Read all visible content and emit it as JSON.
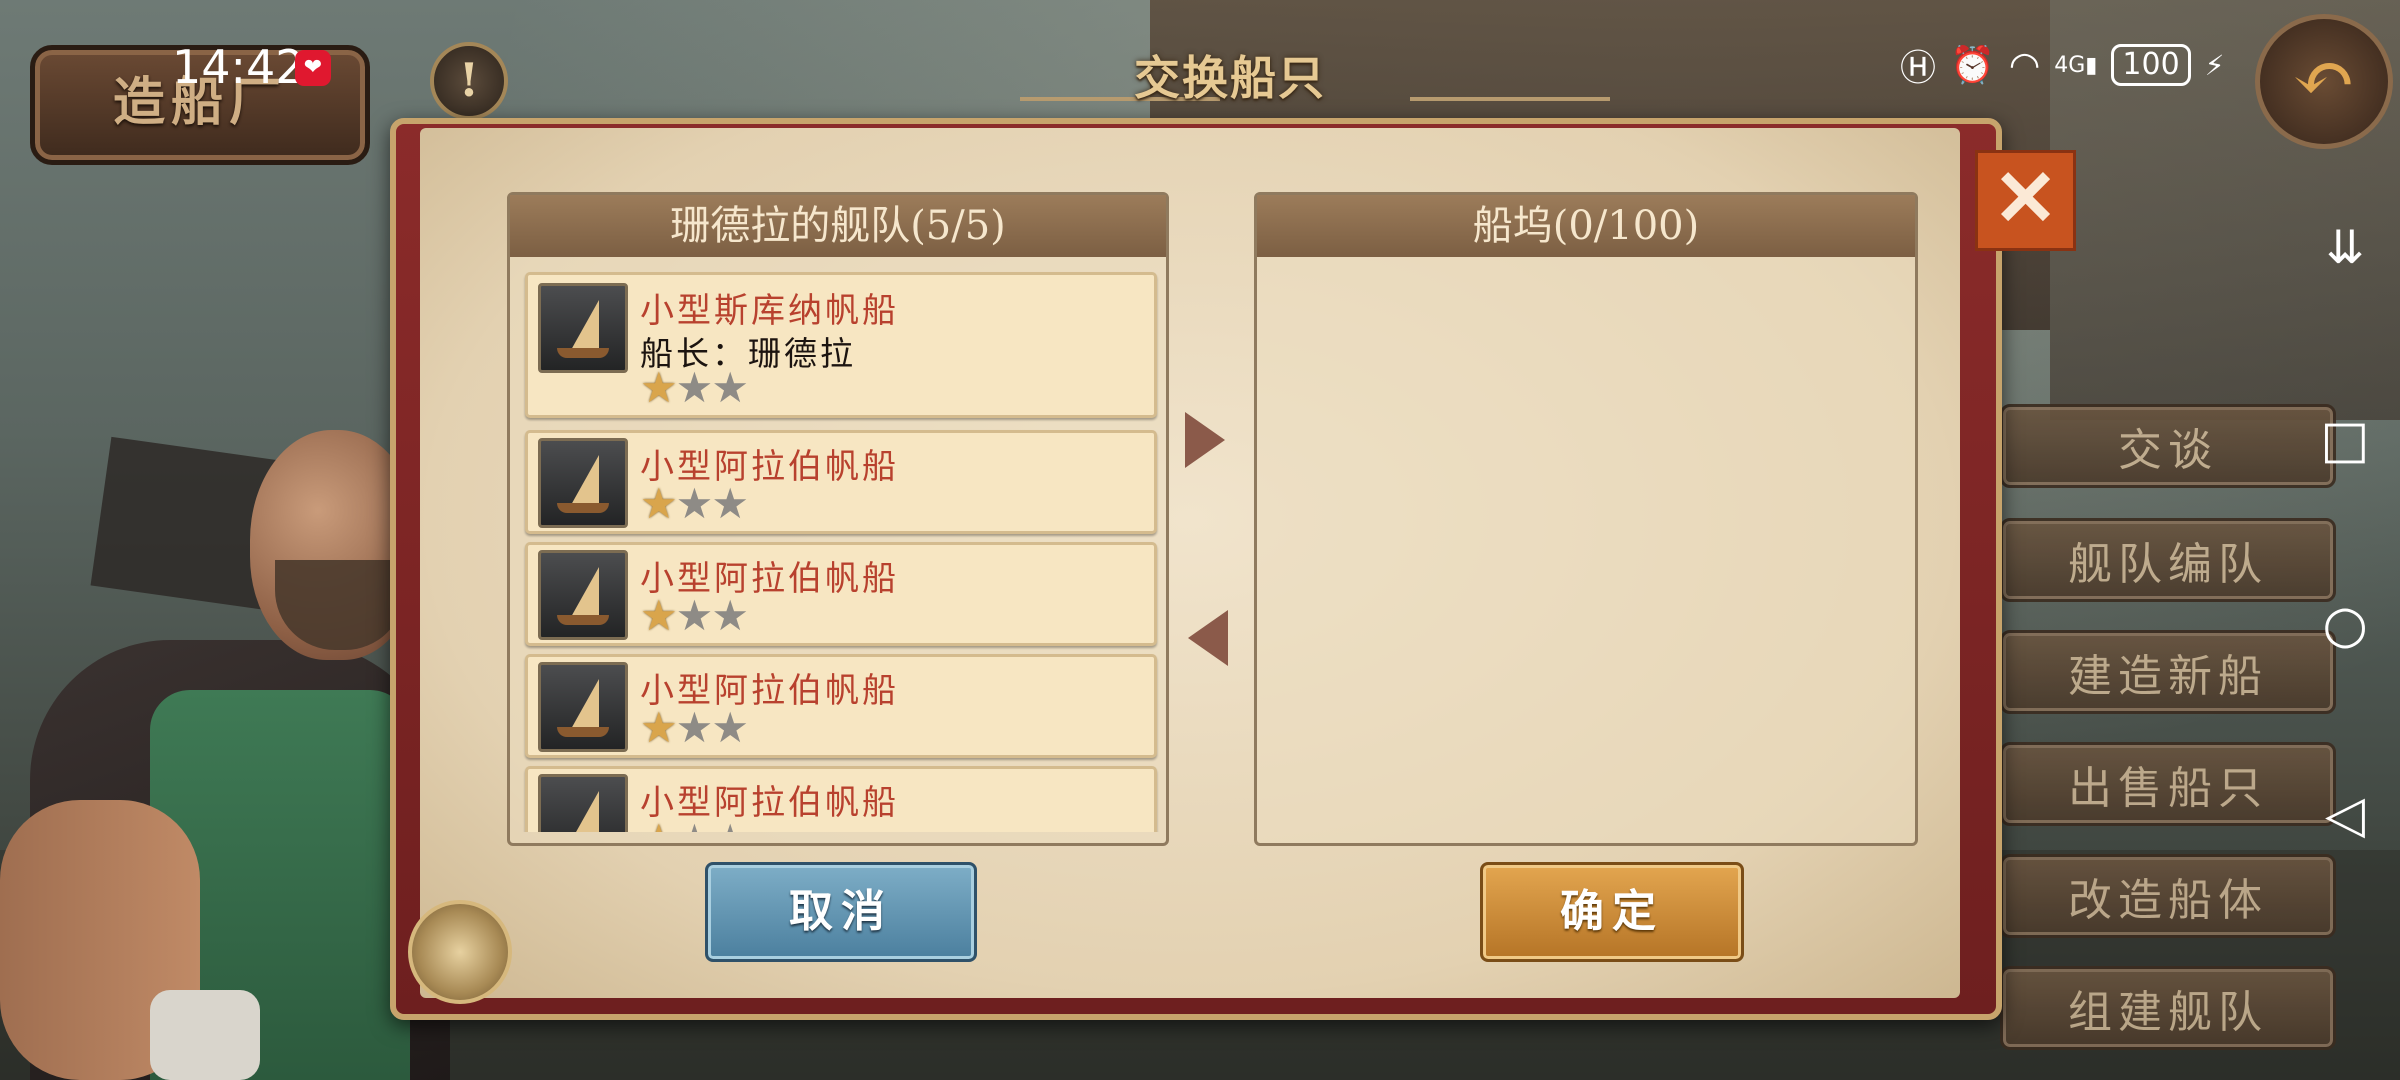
{
  "status_bar": {
    "time": "14:42",
    "heart_icon": "❤",
    "battery": "100"
  },
  "shipyard_sign": "造船厂",
  "page_title": "交换船只",
  "fleet_panel": {
    "title": "珊德拉的舰队(5/5)",
    "ships": [
      {
        "name": "小型斯库纳帆船",
        "captain": "船长：珊德拉",
        "stars": 1,
        "max_stars": 3,
        "icon": "schooner-icon"
      },
      {
        "name": "小型阿拉伯帆船",
        "captain": "",
        "stars": 1,
        "max_stars": 3,
        "icon": "dhow-icon"
      },
      {
        "name": "小型阿拉伯帆船",
        "captain": "",
        "stars": 1,
        "max_stars": 3,
        "icon": "dhow-icon"
      },
      {
        "name": "小型阿拉伯帆船",
        "captain": "",
        "stars": 1,
        "max_stars": 3,
        "icon": "dhow-icon"
      },
      {
        "name": "小型阿拉伯帆船",
        "captain": "",
        "stars": 1,
        "max_stars": 3,
        "icon": "dhow-icon"
      }
    ]
  },
  "dock_panel": {
    "title": "船坞(0/100)"
  },
  "buttons": {
    "cancel": "取消",
    "confirm": "确定",
    "close": "✕",
    "back": "↶",
    "info": "!"
  },
  "side_menu": [
    "交谈",
    "舰队编队",
    "建造新船",
    "出售船只",
    "改造船体",
    "组建舰队"
  ],
  "colors": {
    "ship_name": "#b8412e",
    "modal_border": "#8b2b2a",
    "confirm": "#e3a650",
    "cancel": "#6a9cb9",
    "close": "#c8531f"
  }
}
